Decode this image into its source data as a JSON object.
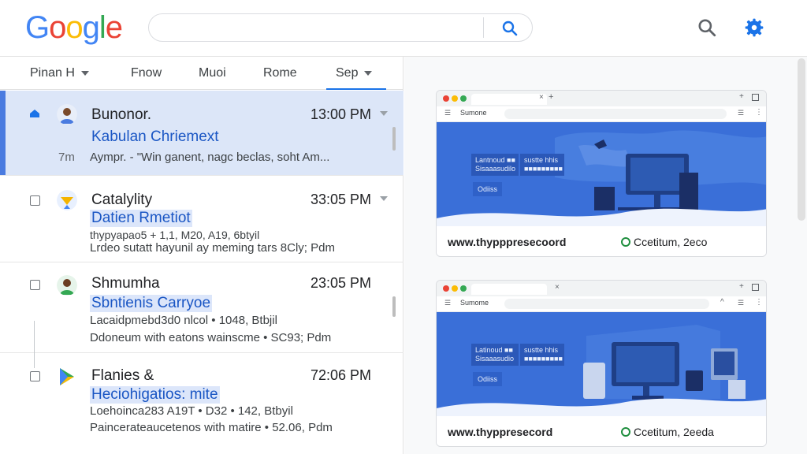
{
  "logo": {
    "letters": [
      "G",
      "o",
      "o",
      "g",
      "l",
      "e"
    ],
    "colors": [
      "#4285F4",
      "#EA4335",
      "#FBBC05",
      "#4285F4",
      "#34A853",
      "#EA4335"
    ]
  },
  "search": {
    "value": "",
    "placeholder": ""
  },
  "tabs": [
    {
      "label": "Pinan H",
      "has_caret": true
    },
    {
      "label": "Fnow",
      "has_caret": false
    },
    {
      "label": "Muoi",
      "has_caret": false
    },
    {
      "label": "Rome",
      "has_caret": false
    },
    {
      "label": "Sep",
      "has_caret": true
    }
  ],
  "emails": [
    {
      "sender": "Bunonor.",
      "time": "13:00 PM",
      "subject": "Kabulan Chriemext",
      "line3_prefix": "7m",
      "line3": "Aympr. - \"Win ganent, nagc beclas, soht Am...",
      "line4": "",
      "selected": true,
      "avatar": "person-icon"
    },
    {
      "sender": "Catalylity",
      "time": "33:05 PM",
      "subject": "Datien Rmetiot",
      "line3": "thypyapao5 + 1,1, M20, A19, 6btyil",
      "line4": "Lrdeo sutatt hayunil ay meming tars 8Cly; Pdm",
      "selected": false,
      "avatar": "star-icon"
    },
    {
      "sender": "Shmumha",
      "time": "23:05 PM",
      "subject": "Sbntienis Carryoe",
      "line3": "Lacaidpmebd3d0 nlcol • 1048, Btbjil",
      "line4": "Ddoneum with eatons wainscme • SC93; Pdm",
      "selected": false,
      "avatar": "person-icon"
    },
    {
      "sender": "Flanies &",
      "time": "72:06 PM",
      "subject": "Heciohigatios: mite",
      "line3": "Loehoinca283 A19T • D32 • 142, Btbyil",
      "line4": "Paincerateaucetenos with matire • 52.06, Pdm",
      "selected": false,
      "avatar": "play-icon"
    }
  ],
  "previews": [
    {
      "tab_text": "Sumone",
      "hero_text1": "Lantnoud ■■\nSisaaasudilo",
      "hero_text2": "sustte hhis\n■■■■■■■■■",
      "cta": "Odiiss",
      "site": "www.thypppresecoord",
      "meta": "Ccetitum, 2eco"
    },
    {
      "tab_text": "Sumome",
      "hero_text1": "Latinoud ■■\nSisaaasudio",
      "hero_text2": "sustte hhis\n■■■■■■■■■",
      "cta": "Odiiss",
      "site": "www.thyppresecord",
      "meta": "Ccetitum, 2eeda"
    }
  ],
  "colors": {
    "accent": "#1a73e8",
    "selected_row": "#dce6f8",
    "hero_blue": "#3a6fd8"
  }
}
